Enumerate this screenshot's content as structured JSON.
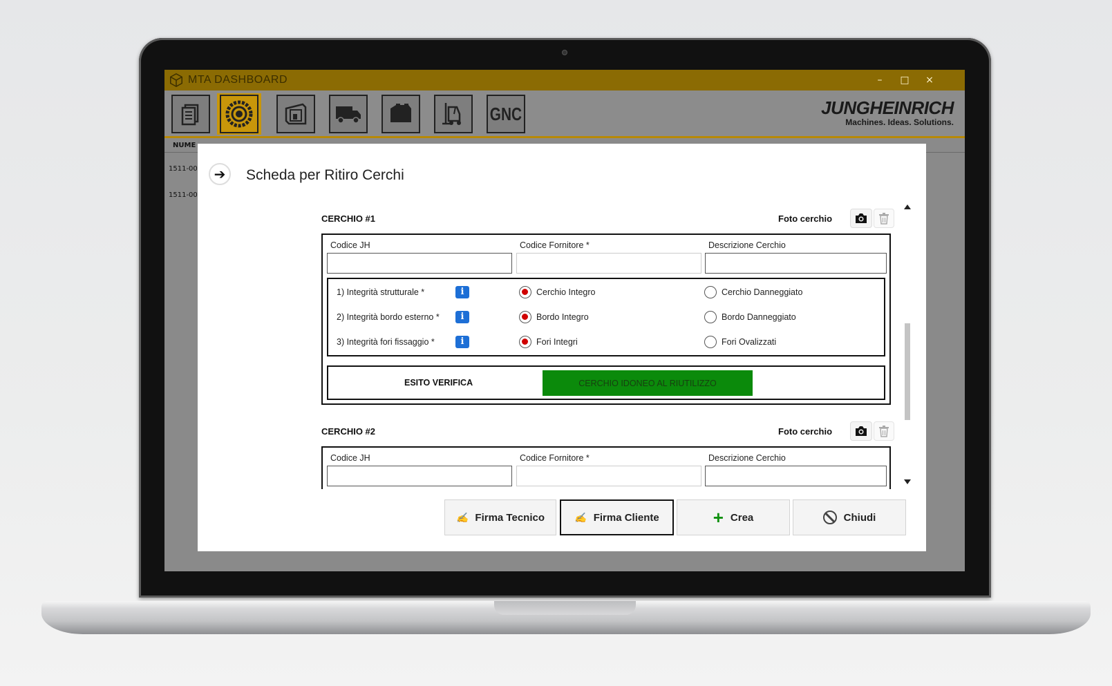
{
  "window": {
    "title": "MTA DASHBOARD",
    "controls": [
      "–",
      "□",
      "×"
    ]
  },
  "toolbar": {
    "buttons": [
      {
        "name": "documents-icon"
      },
      {
        "name": "tire-icon",
        "active": true
      },
      {
        "name": "frame-icon"
      },
      {
        "name": "van-icon"
      },
      {
        "name": "battery-icon"
      },
      {
        "name": "forklift-icon"
      },
      {
        "label": "GNC"
      }
    ]
  },
  "logo": {
    "brand": "JUNGHEINRICH",
    "tagline": "Machines. Ideas. Solutions."
  },
  "background_table": {
    "header": "NUME",
    "rows": [
      "1511-00",
      "1511-00"
    ]
  },
  "dialog": {
    "title": "Scheda per Ritiro Cerchi",
    "cerchi": [
      {
        "heading": "CERCHIO #1",
        "foto_label": "Foto cerchio",
        "fields": [
          {
            "label": "Codice JH",
            "value": ""
          },
          {
            "label": "Codice Fornitore *",
            "value": ""
          },
          {
            "label": "Descrizione Cerchio",
            "value": ""
          }
        ],
        "questions": [
          {
            "label": "1) Integrità strutturale *",
            "option_a": "Cerchio Integro",
            "option_b": "Cerchio Danneggiato",
            "selected": "a"
          },
          {
            "label": "2) Integrità bordo esterno *",
            "option_a": "Bordo Integro",
            "option_b": "Bordo Danneggiato",
            "selected": "a"
          },
          {
            "label": "3) Integrità fori fissaggio *",
            "option_a": "Fori Integri",
            "option_b": "Fori Ovalizzati",
            "selected": "a"
          }
        ],
        "esito_label": "ESITO VERIFICA",
        "esito_result": "CERCHIO IDONEO AL RIUTILIZZO"
      },
      {
        "heading": "CERCHIO #2",
        "foto_label": "Foto cerchio",
        "fields": [
          {
            "label": "Codice JH",
            "value": ""
          },
          {
            "label": "Codice Fornitore *",
            "value": ""
          },
          {
            "label": "Descrizione Cerchio",
            "value": ""
          }
        ]
      }
    ],
    "buttons": {
      "firma_tecnico": "Firma Tecnico",
      "firma_cliente": "Firma Cliente",
      "crea": "Crea",
      "chiudi": "Chiudi"
    }
  },
  "colors": {
    "titlebar": "#8b6b03",
    "accent": "#c8960a",
    "esito_ok": "#0b8a0b",
    "radio_selected": "#d00000",
    "info": "#1d6fd6"
  }
}
